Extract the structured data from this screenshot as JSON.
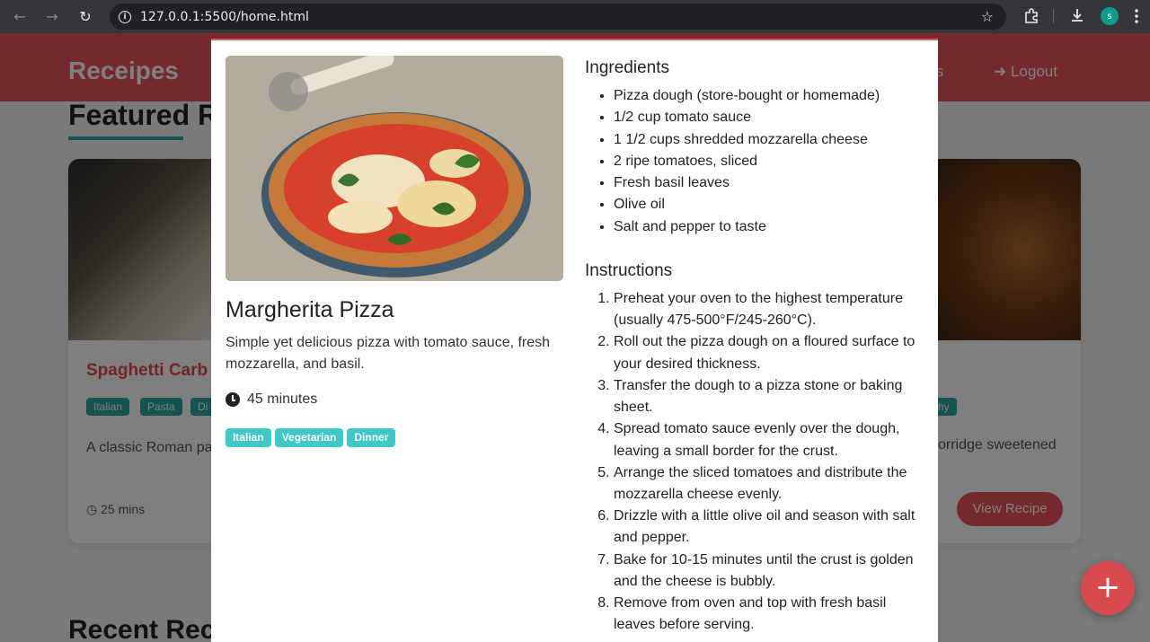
{
  "browser": {
    "url": "127.0.0.1:5500/home.html",
    "profile_initial": "s"
  },
  "site": {
    "logo": "Receipes",
    "nav_favorites": "rites",
    "nav_logout": "Logout",
    "featured_title": "Featured R",
    "recent_title": "Recent Rec",
    "card": {
      "title": "Spaghetti Carb",
      "tags": [
        "Italian",
        "Pasta",
        "Di"
      ],
      "right_tag": "hy",
      "desc_left": "A classic Roman pas cheese, pancetta, ar",
      "desc_right": "orridge sweetened",
      "time": "25 mins",
      "view_button": "View Recipe"
    },
    "fab": "+"
  },
  "modal": {
    "title": "Margherita Pizza",
    "description": "Simple yet delicious pizza with tomato sauce, fresh mozzarella, and basil.",
    "time": "45 minutes",
    "tags": [
      "Italian",
      "Vegetarian",
      "Dinner"
    ],
    "ingredients_heading": "Ingredients",
    "ingredients": [
      "Pizza dough (store-bought or homemade)",
      "1/2 cup tomato sauce",
      "1 1/2 cups shredded mozzarella cheese",
      "2 ripe tomatoes, sliced",
      "Fresh basil leaves",
      "Olive oil",
      "Salt and pepper to taste"
    ],
    "instructions_heading": "Instructions",
    "instructions": [
      "Preheat your oven to the highest temperature (usually 475-500°F/245-260°C).",
      "Roll out the pizza dough on a floured surface to your desired thickness.",
      "Transfer the dough to a pizza stone or baking sheet.",
      "Spread tomato sauce evenly over the dough, leaving a small border for the crust.",
      "Arrange the sliced tomatoes and distribute the mozzarella cheese evenly.",
      "Drizzle with a little olive oil and season with salt and pepper.",
      "Bake for 10-15 minutes until the crust is golden and the cheese is bubbly.",
      "Remove from oven and top with fresh basil leaves before serving."
    ]
  },
  "colors": {
    "brand": "#e8555a",
    "tag": "#3ec8c8",
    "accent": "#2aa6a0"
  }
}
